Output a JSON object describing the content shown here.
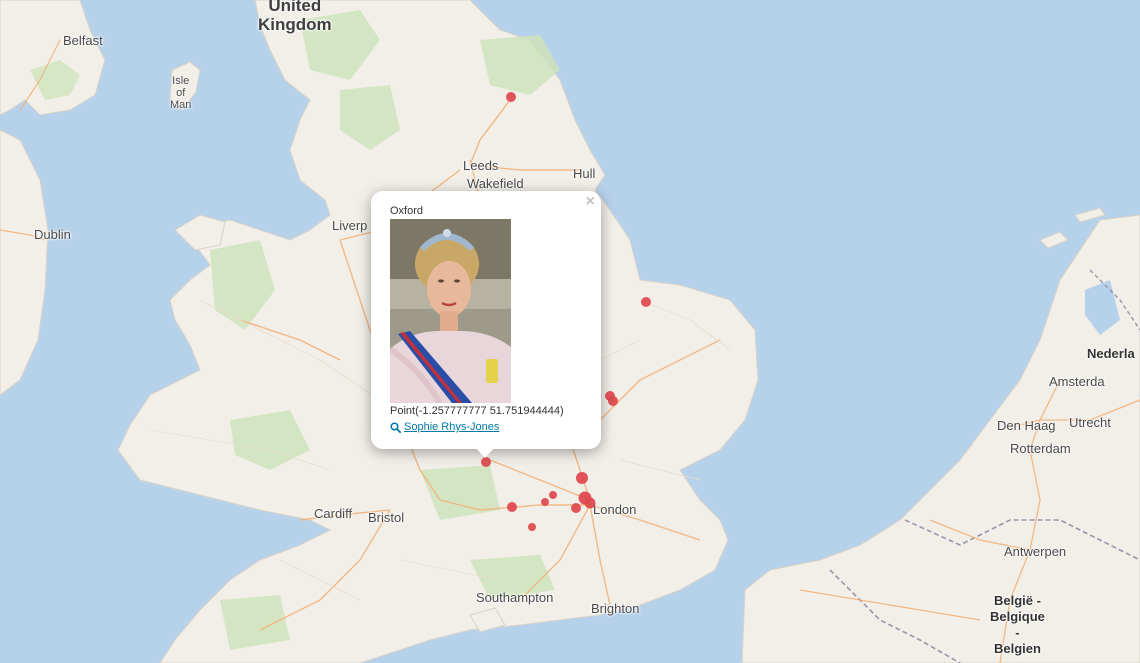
{
  "map": {
    "place_labels": {
      "united_kingdom": "United\nKingdom",
      "belfast": "Belfast",
      "isle_of_man": "Isle\nof\nMan",
      "dublin": "Dublin",
      "leeds": "Leeds",
      "wakefield": "Wakefield",
      "hull": "Hull",
      "liverpool": "Liverp",
      "cardiff": "Cardiff",
      "bristol": "Bristol",
      "london": "London",
      "southampton": "Southampton",
      "brighton": "Brighton",
      "nederland": "Nederla",
      "amsterdam": "Amsterda",
      "den_haag": "Den Haag",
      "utrecht": "Utrecht",
      "rotterdam": "Rotterdam",
      "antwerpen": "Antwerpen",
      "belgie": "België -\nBelgique\n-\nBelgien"
    },
    "marker_color": "#e0474c"
  },
  "popup": {
    "title": "Oxford",
    "photo_subject": "Sophie Rhys-Jones portrait",
    "point_text": "Point(-1.257777777 51.751944444)",
    "link_text": "Sophie Rhys-Jones",
    "close_symbol": "×",
    "link_icon": "search-icon"
  }
}
